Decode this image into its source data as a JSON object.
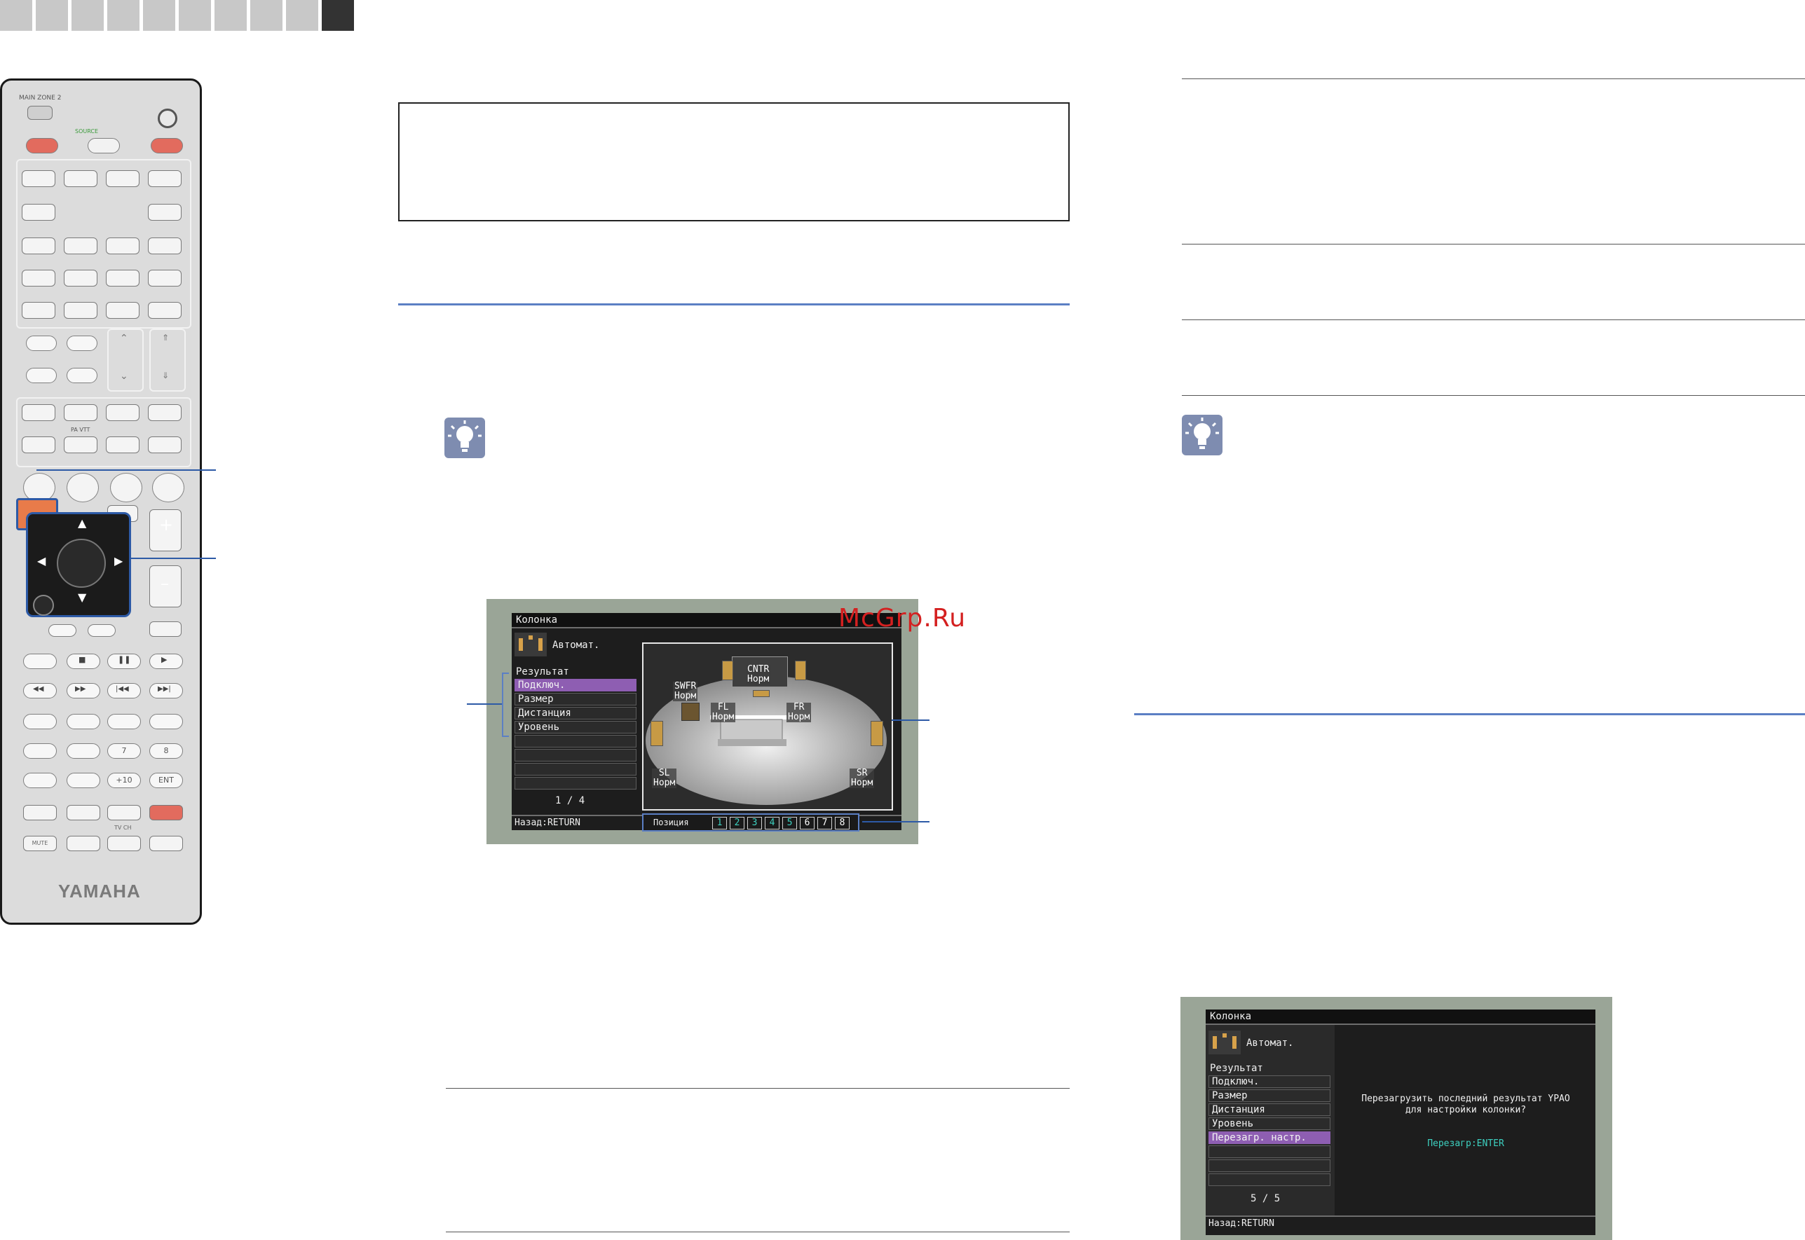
{
  "watermark": "McGrp.Ru",
  "remote": {
    "brand": "YAMAHA",
    "labels": {
      "main_zone": "MAIN   ZONE 2",
      "source": "SOURCE",
      "pa_vtt": "PA VTT",
      "tv_ch": "TV CH",
      "mute": "MUTE",
      "btn_7": "7",
      "btn_8": "8",
      "btn_10": "+10",
      "btn_ent": "ENT"
    },
    "colors": {
      "highlight": "#e87b4a",
      "power": "#e26b5e",
      "dpad": "#1b1b1b"
    }
  },
  "screen1": {
    "title": "Колонка",
    "mode": "Автомат.",
    "result_label": "Результат",
    "menu": [
      "Подключ.",
      "Размер",
      "Дистанция",
      "Уровень"
    ],
    "selected_index": 0,
    "page": "1 / 4",
    "back": "Назад:RETURN",
    "speakers": {
      "center": {
        "name": "CNTR",
        "status": "Норм"
      },
      "subwoofer": {
        "name": "SWFR",
        "status": "Норм"
      },
      "front_left": {
        "name": "FL",
        "status": "Норм"
      },
      "front_right": {
        "name": "FR",
        "status": "Норм"
      },
      "surround_left": {
        "name": "SL",
        "status": "Норм"
      },
      "surround_right": {
        "name": "SR",
        "status": "Норм"
      }
    },
    "position_label": "Позиция",
    "positions": [
      "1",
      "2",
      "3",
      "4",
      "5",
      "6",
      "7",
      "8"
    ],
    "positions_measured": 5
  },
  "screen2": {
    "title": "Колонка",
    "mode": "Автомат.",
    "result_label": "Результат",
    "menu": [
      "Подключ.",
      "Размер",
      "Дистанция",
      "Уровень",
      "Перезагр. настр."
    ],
    "selected_index": 4,
    "page": "5 / 5",
    "back": "Назад:RETURN",
    "message_line1": "Перезагрузить последний результат YPAO",
    "message_line2": "для настройки колонки?",
    "action": "Перезагр:ENTER"
  }
}
